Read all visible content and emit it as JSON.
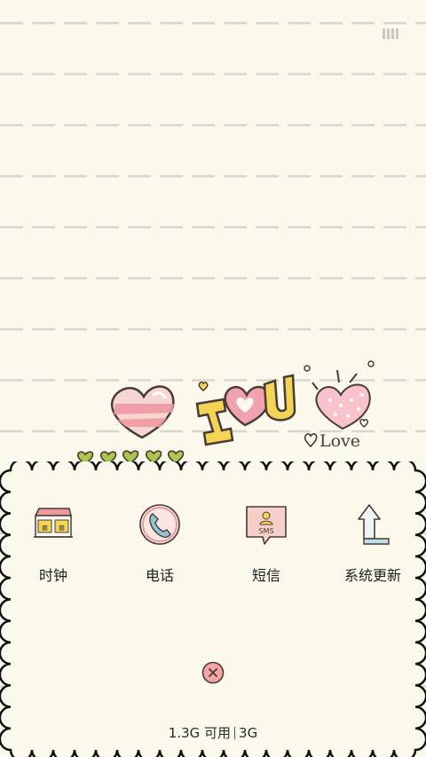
{
  "apps": [
    {
      "label": "时钟",
      "icon": "clock-icon"
    },
    {
      "label": "电话",
      "icon": "phone-icon"
    },
    {
      "label": "短信",
      "icon": "sms-icon"
    },
    {
      "label": "系统更新",
      "icon": "system-update-icon"
    }
  ],
  "sms_icon_text": "SMS",
  "clock_icon_text": "2013 1043",
  "stickers": {
    "i_letter": "I",
    "u_letter": "U",
    "love_text": "Love"
  },
  "storage": {
    "free": "1.3G 可用",
    "network": "3G"
  },
  "colors": {
    "background": "#fbf9ec",
    "line": "#d9d7cd",
    "panel": "#fbf9ec",
    "accent_pink": "#f2a7a4",
    "accent_yellow": "#f3d454",
    "accent_green": "#a9c64f"
  }
}
